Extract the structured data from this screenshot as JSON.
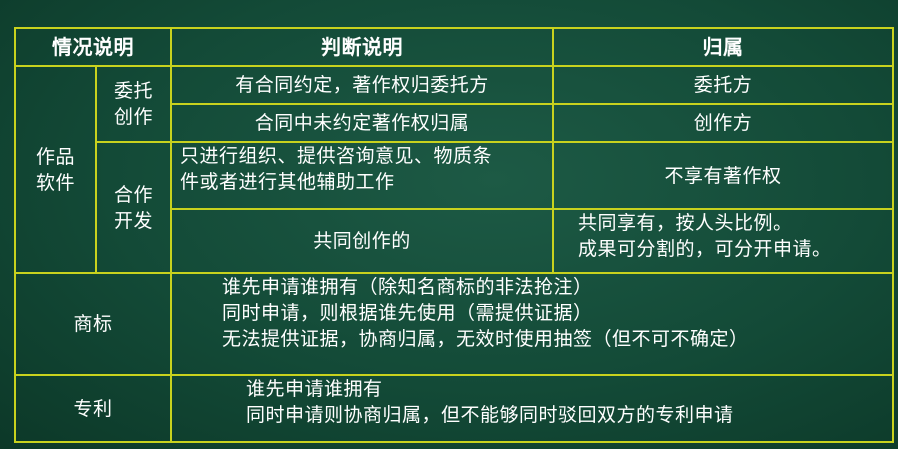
{
  "header": {
    "situation": "情况说明",
    "judgment": "判断说明",
    "ownership": "归属"
  },
  "software": {
    "category": [
      "作品",
      "软件"
    ],
    "commissioned": {
      "label": [
        "委托",
        "创作"
      ],
      "rows": [
        {
          "judgment": "有合同约定，著作权归委托方",
          "ownership": "委托方"
        },
        {
          "judgment": "合同中未约定著作权归属",
          "ownership": "创作方"
        }
      ]
    },
    "cooperative": {
      "label": [
        "合作",
        "开发"
      ],
      "rows": [
        {
          "judgment": [
            "只进行组织、提供咨询意见、物质条",
            "件或者进行其他辅助工作"
          ],
          "ownership": [
            "不享有著作权"
          ]
        },
        {
          "judgment": [
            "共同创作的"
          ],
          "ownership": [
            "共同享有，按人头比例。",
            "成果可分割的，可分开申请。"
          ]
        }
      ]
    }
  },
  "trademark": {
    "label": "商标",
    "lines": [
      "谁先申请谁拥有（除知名商标的非法抢注）",
      "同时申请，则根据谁先使用（需提供证据）",
      "无法提供证据，协商归属，无效时使用抽签（但不可不确定）"
    ]
  },
  "patent": {
    "label": "专利",
    "lines": [
      "谁先申请谁拥有",
      "同时申请则协商归属，但不能够同时驳回双方的专利申请"
    ]
  },
  "colors": {
    "board": "#134a37",
    "line": "#c8d21e",
    "text": "#ffffff"
  }
}
